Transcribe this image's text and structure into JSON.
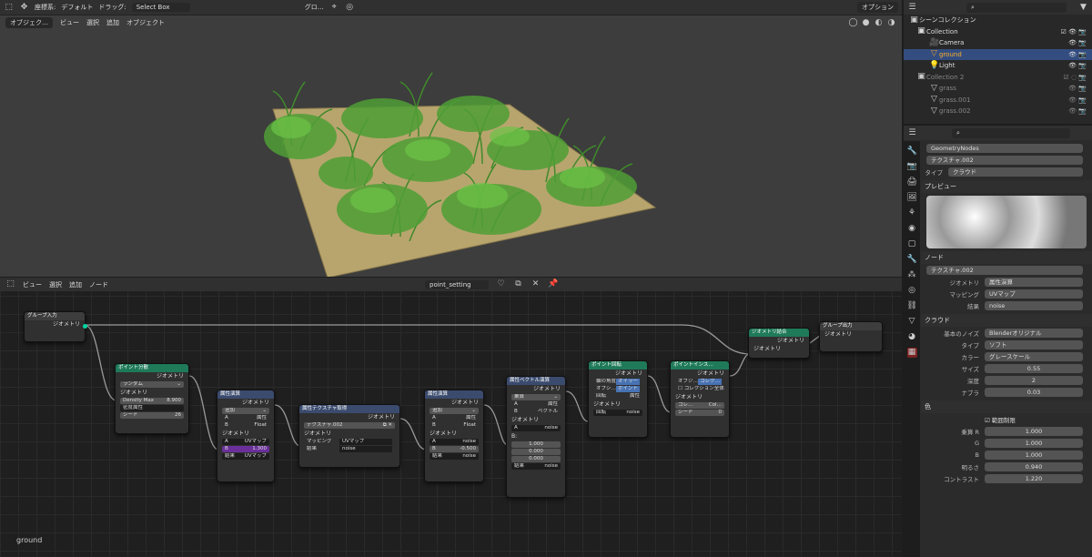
{
  "viewport": {
    "coord_label": "座標系:",
    "orientation": "デフォルト",
    "drag_label": "ドラッグ:",
    "drag_value": "Select Box",
    "pivot": "グロ…",
    "options": "オプション",
    "mode": "オブジェク…",
    "menu": [
      "ビュー",
      "選択",
      "追加",
      "オブジェクト"
    ]
  },
  "node_editor": {
    "menu": [
      "ビュー",
      "選択",
      "追加",
      "ノード"
    ],
    "tree_name": "point_setting",
    "footer_label": "ground"
  },
  "nodes": {
    "group_in": {
      "title": "グループ入力",
      "geo": "ジオメトリ"
    },
    "distribute": {
      "title": "ポイント分散",
      "geo_out": "ジオメトリ",
      "mode": "ランダム",
      "geo_in": "ジオメトリ",
      "density_max_label": "Density Max",
      "density_max": "8.900",
      "density_attr": "密度属性",
      "seed_label": "シード",
      "seed": "26"
    },
    "attr_math1": {
      "title": "属性演算",
      "geo_out": "ジオメトリ",
      "op": "追加",
      "a": "A",
      "a_type": "属性",
      "b": "B",
      "b_type": "Float",
      "geo_in": "ジオメトリ",
      "in_a": "A",
      "in_a_val": "UVマップ",
      "in_b": "B",
      "in_b_val": "1.300",
      "result": "結果",
      "result_val": "UVマップ"
    },
    "attr_tex": {
      "title": "属性テクスチャ取得",
      "geo_out": "ジオメトリ",
      "tex": "テクスチャ.002",
      "geo_in": "ジオメトリ",
      "mapping": "マッピング",
      "mapping_val": "UVマップ",
      "result": "結果",
      "result_val": "noise"
    },
    "attr_math2": {
      "title": "属性演算",
      "geo_out": "ジオメトリ",
      "op": "追加",
      "a": "A",
      "a_type": "属性",
      "b": "B",
      "b_type": "Float",
      "geo_in": "ジオメトリ",
      "in_a": "A",
      "in_a_val": "noise",
      "in_b": "B",
      "in_b_val": "-0.500",
      "result": "結果",
      "result_val": "noise"
    },
    "vec_math": {
      "title": "属性ベクトル演算",
      "geo_out": "ジオメトリ",
      "op": "乗算",
      "a": "A",
      "a_type": "属性",
      "b": "B",
      "b_type": "ベクトル",
      "geo_in": "ジオメトリ",
      "in_a": "A",
      "in_a_val": "noise",
      "in_b": "B:",
      "b1": "1.000",
      "b2": "0.000",
      "b3": "0.000",
      "result": "結果",
      "result_val": "noise"
    },
    "rotate": {
      "title": "ポイント回転",
      "geo_out": "ジオメトリ",
      "axis_label": "軸の角度",
      "axis_val": "オイラー",
      "opt_label": "オプシ…",
      "opt_val": "ポイント",
      "rot_label": "回転",
      "rot_type": "属性",
      "geo_in": "ジオメトリ",
      "rot_in": "回転",
      "rot_in_val": "noise"
    },
    "instance": {
      "title": "ポイントインス…",
      "geo_out": "ジオメトリ",
      "opt_label": "オブジ…",
      "opt_val": "コレク…",
      "whole": "コレクション全体",
      "geo_in": "ジオメトリ",
      "coll_label": "コレ…",
      "coll_val": "Col…",
      "seed_label": "シード",
      "seed_val": "0"
    },
    "join": {
      "title": "ジオメトリ結合",
      "geo_out": "ジオメトリ",
      "geo_in": "ジオメトリ"
    },
    "group_out": {
      "title": "グループ出力",
      "geo": "ジオメトリ"
    }
  },
  "outliner": {
    "title": "シーンコレクション",
    "items": [
      {
        "label": "Collection",
        "level": 1
      },
      {
        "label": "Camera",
        "level": 2
      },
      {
        "label": "ground",
        "level": 2,
        "selected": true
      },
      {
        "label": "Light",
        "level": 2
      },
      {
        "label": "Collection 2",
        "level": 1,
        "dim": true
      },
      {
        "label": "grass",
        "level": 2,
        "dim": true
      },
      {
        "label": "grass.001",
        "level": 2,
        "dim": true
      },
      {
        "label": "grass.002",
        "level": 2,
        "dim": true
      }
    ]
  },
  "props": {
    "modifier": "GeometryNodes",
    "texture": "テクスチャ.002",
    "type_label": "タイプ",
    "type_val": "クラウド",
    "preview": "プレビュー",
    "node_sec": "ノード",
    "node_tex": "テクスチャ.002",
    "geo_label": "ジオメトリ",
    "geo_val": "属性演算",
    "map_label": "マッピング",
    "map_val": "UVマップ",
    "res_label": "結果",
    "res_val": "noise",
    "cloud_sec": "クラウド",
    "basis_label": "基本のノイズ",
    "basis_val": "Blenderオリジナル",
    "ctype_label": "タイプ",
    "ctype_val": "ソフト",
    "color_label": "カラー",
    "color_val": "グレースケール",
    "size_label": "サイズ",
    "size_val": "0.55",
    "depth_label": "深度",
    "depth_val": "2",
    "nabla_label": "ナブラ",
    "nabla_val": "0.03",
    "color_sec": "色",
    "clamp": "範囲制限",
    "r_label": "乗算 R",
    "r_val": "1.000",
    "g_label": "G",
    "g_val": "1.000",
    "b_label": "B",
    "b_val": "1.000",
    "bright_label": "明るさ",
    "bright_val": "0.940",
    "contrast_label": "コントラスト",
    "contrast_val": "1.220"
  }
}
